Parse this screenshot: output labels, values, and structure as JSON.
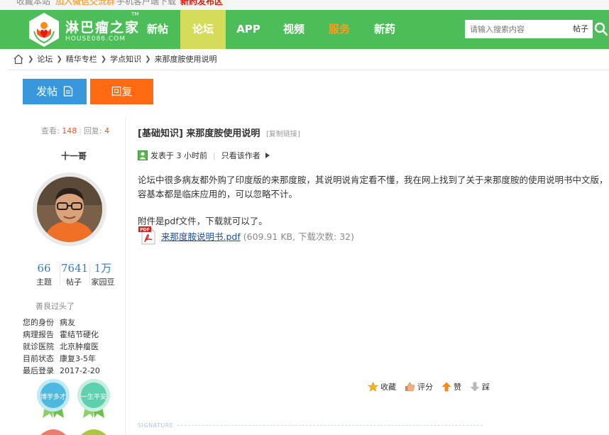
{
  "topbar": {
    "bookmark": "收藏本站",
    "wechat_group": "加入微信交流群",
    "mobile_app": "手机客户端下载",
    "new_drug": "新药发布区"
  },
  "brand": {
    "name_cn": "淋巴瘤之家",
    "name_en": "HOUSE086.COM",
    "tm": "TM"
  },
  "nav": {
    "items": [
      {
        "label": "新帖"
      },
      {
        "label": "论坛"
      },
      {
        "label": "APP"
      },
      {
        "label": "视频"
      },
      {
        "label": "服务"
      },
      {
        "label": "新药"
      }
    ],
    "search_placeholder": "请输入搜索内容",
    "search_type": "帖子"
  },
  "breadcrumb": [
    "论坛",
    "精华专栏",
    "学点知识",
    "来那度胺使用说明"
  ],
  "buttons": {
    "post": "发帖",
    "reply": "回复"
  },
  "author": {
    "views_label": "查看:",
    "views": "148",
    "replies_label": "回复:",
    "replies": "4",
    "username": "十一哥",
    "topics": "66",
    "topics_label": "主题",
    "posts": "7641",
    "posts_label": "帖子",
    "beans": "1万",
    "beans_label": "家园豆",
    "motto": "善良过头了",
    "info": [
      {
        "k": "您的身份",
        "v": "病友"
      },
      {
        "k": "病理报告",
        "v": "霍结节硬化"
      },
      {
        "k": "就诊医院",
        "v": "北京肿瘤医"
      },
      {
        "k": "目前状态",
        "v": "康复3-5年"
      },
      {
        "k": "最后登录",
        "v": "2017-2-20"
      }
    ],
    "medals": [
      "博学多才",
      "一生平安"
    ]
  },
  "post": {
    "title": "[基础知识] 来那度胺使用说明",
    "copy_link": "[复制链接]",
    "posted": "发表于 3 小时前",
    "author_only": "只看该作者",
    "line1": "论坛中很多病友都外购了印度版的来那度胺，其说明说肯定看不懂，我在网上找到了关于来那度胺的使用说明书中文版，",
    "line2": "容基本都是临床应用的，可以忽略不计。",
    "line3": "附件是pdf文件，下载就可以了。",
    "attachment_name": "来那度胺说明书.pdf",
    "attachment_meta": "(609.91 KB, 下载次数: 32)",
    "pdf_badge": "PDF"
  },
  "actions": {
    "favorite": "收藏",
    "rate": "评分",
    "like": "赞",
    "dislike": "踩"
  },
  "signature_label": "SIGNATURE",
  "colors": {
    "nav_green": "#4dbd5a",
    "nav_active": "#d4dc5a",
    "post_blue": "#3898db",
    "reply_orange": "#ff6a13",
    "link_blue": "#1d4ea0"
  }
}
